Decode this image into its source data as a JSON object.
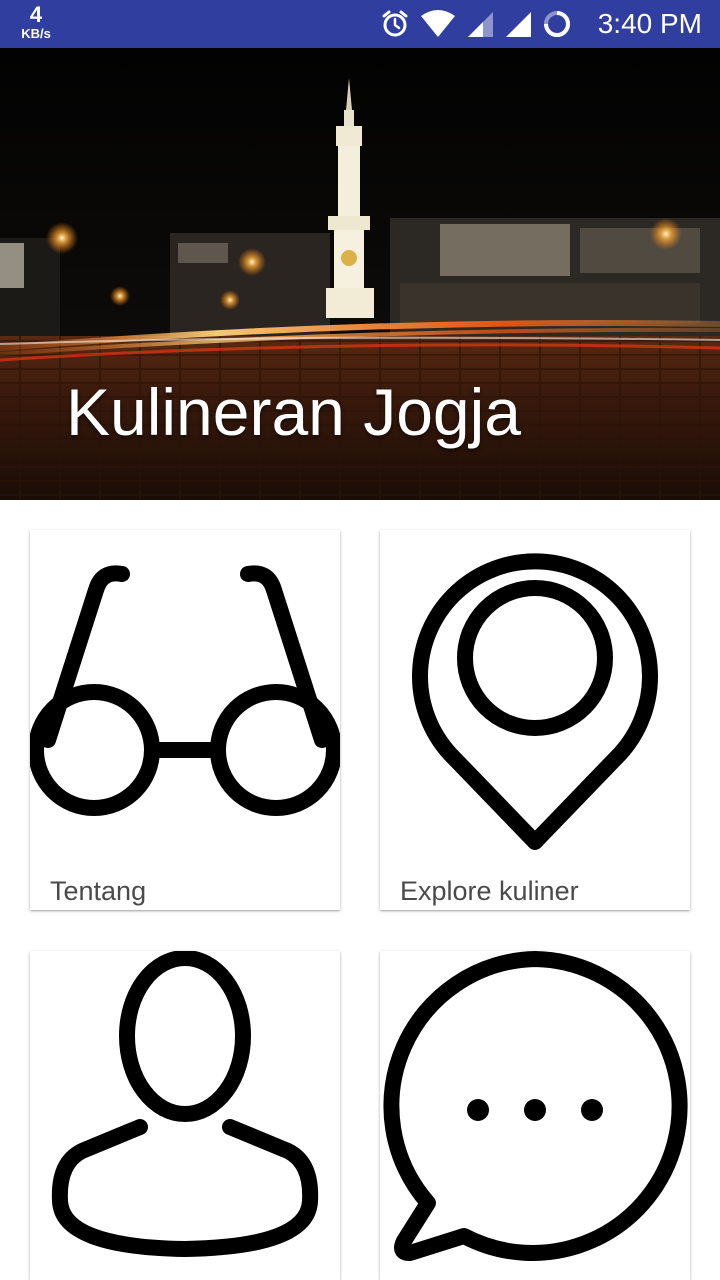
{
  "status_bar": {
    "net_speed_value": "4",
    "net_speed_unit": "KB/s",
    "icons": [
      "alarm-icon",
      "wifi-icon",
      "signal-icon",
      "signal-icon",
      "loading-ring-icon"
    ],
    "time": "3:40 PM",
    "background_color": "#303f9f"
  },
  "header": {
    "title": "Kulineran Jogja",
    "image_icon": "tugu-night-photo"
  },
  "menu": {
    "items": [
      {
        "label": "Tentang",
        "icon": "glasses-icon"
      },
      {
        "label": "Explore kuliner",
        "icon": "map-pin-icon"
      },
      {
        "label": "",
        "icon": "user-icon"
      },
      {
        "label": "",
        "icon": "chat-bubble-icon"
      }
    ]
  }
}
